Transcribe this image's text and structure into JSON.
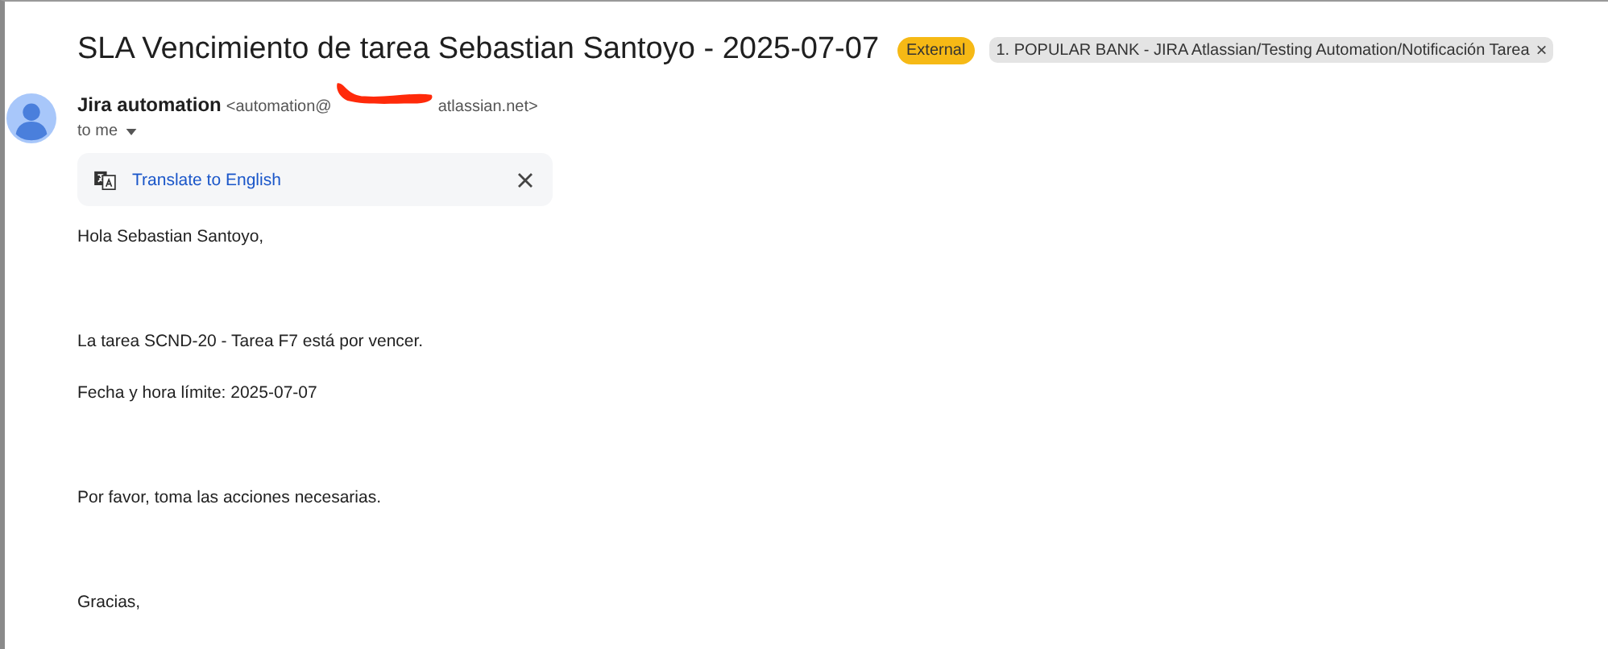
{
  "subject": "SLA Vencimiento de tarea Sebastian Santoyo - 2025-07-07",
  "labels": [
    {
      "kind": "external",
      "text": "External"
    },
    {
      "kind": "folder",
      "text": "1. POPULAR BANK - JIRA Atlassian/Testing Automation/Notificación Tarea",
      "remove": "×"
    }
  ],
  "sender": {
    "name": "Jira automation",
    "email_start": "<automation@",
    "email_end": "atlassian.net>",
    "redacted": true
  },
  "recipient": "to me",
  "translate": {
    "link": "Translate to English"
  },
  "body": [
    "Hola Sebastian Santoyo,",
    "La tarea SCND-20 - Tarea F7 está por vencer.",
    "Fecha y hora límite: 2025-07-07",
    "Por favor, toma las acciones necesarias.",
    "Gracias,"
  ]
}
